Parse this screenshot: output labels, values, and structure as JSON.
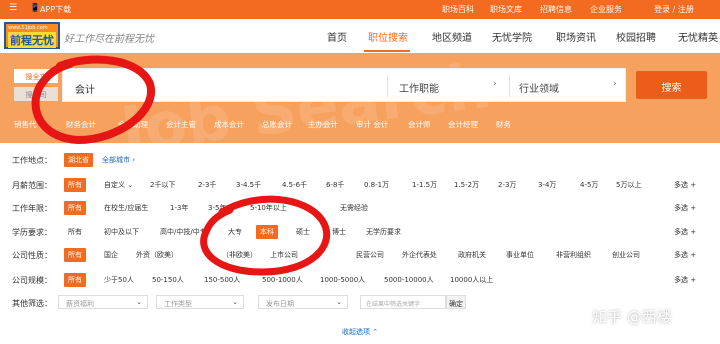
{
  "topbar": {
    "app_icon": "📱",
    "app_download": "APP下载",
    "links": [
      "职场百科",
      "职场文库",
      "招聘信息",
      "企业服务"
    ],
    "auth": "登录 / 注册"
  },
  "header": {
    "logo_url": "www.51job.com",
    "logo_name": "前程无忧",
    "slogan": "好工作尽在前程无忧",
    "nav": [
      "首页",
      "职位搜索",
      "地区频道",
      "无忧学院",
      "职场资讯",
      "校园招聘",
      "无忧精英"
    ],
    "active_nav": "职位搜索"
  },
  "search": {
    "tabs": [
      "搜全文",
      "搜公司"
    ],
    "keyword": "会计",
    "job_function": "工作职能",
    "industry": "行业领域",
    "button": "搜索",
    "hot_words": [
      "销售代",
      "财务会计",
      "会计助理",
      "会计主管",
      "成本会计",
      "总账会计",
      "主办会计",
      "审计 会计",
      "会计师",
      "会计经理",
      "财务"
    ]
  },
  "filters": [
    {
      "label": "工作地点：",
      "options": [
        "湖北省",
        "全部城市 ›"
      ],
      "selected": 0
    },
    {
      "label": "月薪范围：",
      "options": [
        "所有",
        "自定义 ⌄",
        "2千以下",
        "2-3千",
        "3-4.5千",
        "4.5-6千",
        "6-8千",
        "0.8-1万",
        "1-1.5万",
        "1.5-2万",
        "2-3万",
        "3-4万",
        "4-5万",
        "5万以上"
      ],
      "selected": 0,
      "more": "多选 +"
    },
    {
      "label": "工作年限：",
      "options": [
        "所有",
        "在校生/应届生",
        "1-3年",
        "3-5年",
        "5-10年以上",
        "无需经验"
      ],
      "selected": 0,
      "more": "多选 +"
    },
    {
      "label": "学历要求：",
      "options": [
        "所有",
        "初中及以下",
        "高中/中技/中专",
        "大专",
        "本科",
        "硕士",
        "博士",
        "无学历要求"
      ],
      "selected": 4,
      "more": "多选 +"
    },
    {
      "label": "公司性质：",
      "options": [
        "所有",
        "国企",
        "外资（欧美）",
        "（非欧美）",
        "上市公司",
        "民营公司",
        "外企代表处",
        "政府机关",
        "事业单位",
        "非营利组织",
        "创业公司"
      ],
      "selected": 0,
      "more": "多选 +"
    },
    {
      "label": "公司规模：",
      "options": [
        "所有",
        "少于50人",
        "50-150人",
        "150-500人",
        "500-1000人",
        "1000-5000人",
        "5000-10000人",
        "10000人以上"
      ],
      "selected": 0,
      "more": "多选 +"
    }
  ],
  "other": {
    "label": "其他筛选：",
    "welfare": "薪资福利",
    "job_type": "工作类型",
    "post_date": "发布日期",
    "keyword_placeholder": "在结果中筛选关键字",
    "confirm": "确定"
  },
  "collapse": "收起选项 ⌃",
  "watermark_text": "Job Search",
  "credit": "知乎 @西楼",
  "colors": {
    "brand": "#f26b21",
    "search_button": "#ec5d19",
    "annotation": "#e81515"
  }
}
